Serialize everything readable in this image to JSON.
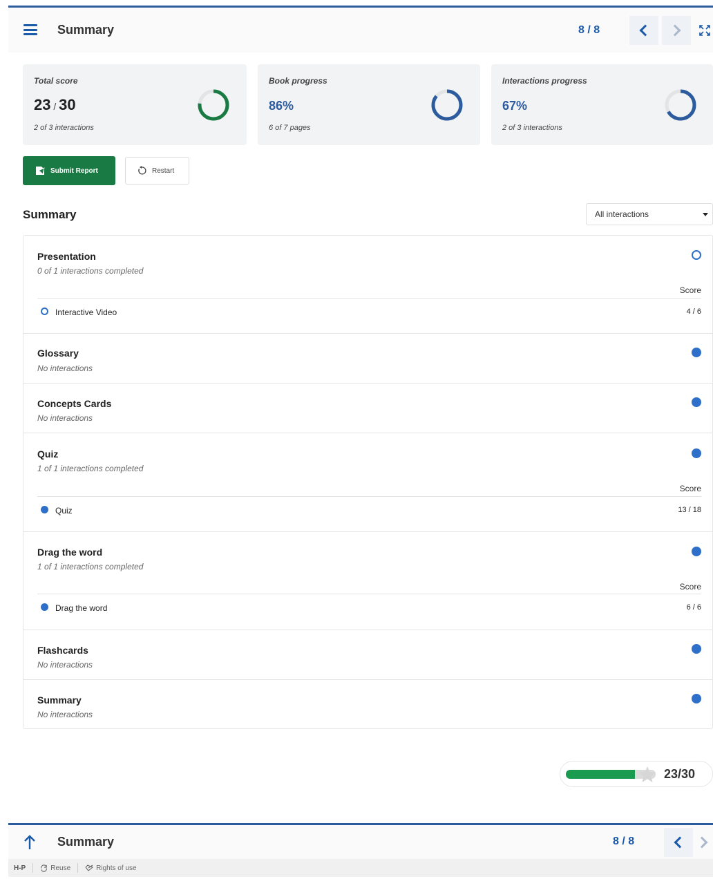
{
  "header": {
    "title": "Summary",
    "page_counter": "8 / 8",
    "prev_icon": "chevron-left-icon",
    "next_icon": "chevron-right-icon",
    "expand_icon": "fullscreen-icon"
  },
  "cards": {
    "total": {
      "label": "Total score",
      "score": "23",
      "sep": " / ",
      "max": "30",
      "sub": "2 of 3 interactions",
      "progress": 0.767
    },
    "book": {
      "label": "Book progress",
      "value": "86%",
      "sub": "6 of 7 pages",
      "progress": 0.86
    },
    "interactions": {
      "label": "Interactions progress",
      "value": "67%",
      "sub": "2 of 3 interactions",
      "progress": 0.67
    }
  },
  "colors": {
    "green": "#1a7a44",
    "blue": "#2d5c9e",
    "dot_blue": "#2e6fc9"
  },
  "actions": {
    "submit_label": "Submit Report",
    "restart_label": "Restart"
  },
  "summary": {
    "title": "Summary",
    "filter_value": "All interactions",
    "score_label": "Score",
    "chapters": [
      {
        "title": "Presentation",
        "sub": "0 of 1 interactions completed",
        "item_name": "Interactive Video",
        "item_score": "4 / 6"
      },
      {
        "title": "Glossary",
        "sub": "No interactions"
      },
      {
        "title": "Concepts Cards",
        "sub": "No interactions"
      },
      {
        "title": "Quiz",
        "sub": "1 of 1 interactions completed",
        "item_name": "Quiz",
        "item_score": "13 / 18"
      },
      {
        "title": "Drag the word",
        "sub": "1 of 1 interactions completed",
        "item_name": "Drag the word",
        "item_score": "6 / 6"
      },
      {
        "title": "Flashcards",
        "sub": "No interactions"
      },
      {
        "title": "Summary",
        "sub": "No interactions"
      }
    ]
  },
  "total_bar": {
    "text": "23/30",
    "progress": 0.767
  },
  "footer": {
    "title": "Summary",
    "page_counter": "8 / 8",
    "brand": "H-P",
    "reuse": "Reuse",
    "rights": "Rights of use"
  }
}
